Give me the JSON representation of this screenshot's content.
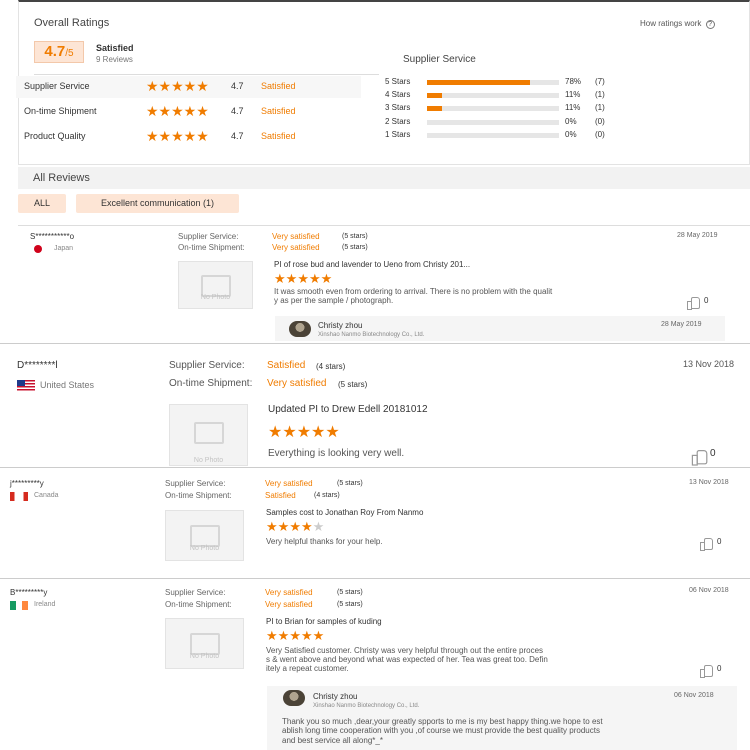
{
  "overall": {
    "title": "Overall Ratings",
    "how_link": "How ratings work",
    "score": "4.7",
    "score_suffix": "/5",
    "score_label": "Satisfied",
    "reviews_count": "9 Reviews",
    "rows": [
      {
        "label": "Supplier Service",
        "value": "4.7",
        "text": "Satisfied"
      },
      {
        "label": "On-time Shipment",
        "value": "4.7",
        "text": "Satisfied"
      },
      {
        "label": "Product Quality",
        "value": "4.7",
        "text": "Satisfied"
      }
    ],
    "supplier_service_title": "Supplier Service",
    "bars": [
      {
        "label": "5 Stars",
        "fraction": 0.78,
        "pct": "78%",
        "count": "(7)"
      },
      {
        "label": "4 Stars",
        "fraction": 0.11,
        "pct": "11%",
        "count": "(1)"
      },
      {
        "label": "3 Stars",
        "fraction": 0.11,
        "pct": "11%",
        "count": "(1)"
      },
      {
        "label": "2 Stars",
        "fraction": 0,
        "pct": "0%",
        "count": "(0)"
      },
      {
        "label": "1 Stars",
        "fraction": 0,
        "pct": "0%",
        "count": "(0)"
      }
    ]
  },
  "all_reviews": {
    "title": "All Reviews",
    "filters": [
      "ALL",
      "Excellent communication (1)"
    ]
  },
  "reviews": [
    {
      "name": "S***********o",
      "country": "Japan",
      "date": "28 May 2019",
      "ss_label": "Supplier Service:",
      "ss_value": "Very satisfied",
      "ss_stars": "(5 stars)",
      "os_label": "On-time Shipment:",
      "os_value": "Very satisfied",
      "os_stars": "(5 stars)",
      "product": "PI of rose bud and lavender to Ueno from Christy 201...",
      "rating": 5,
      "text_l1": "It was smooth even from ordering to arrival. There is no problem with the qualit",
      "text_l2": "y as per the sample / photograph.",
      "likes": "0",
      "no_photo": "No Photo",
      "reply": {
        "name": "Christy zhou",
        "company": "Xinshao Nanmo Biotechnology Co., Ltd.",
        "date": "28 May 2019"
      }
    },
    {
      "name": "D********l",
      "country": "United States",
      "date": "13 Nov 2018",
      "ss_label": "Supplier Service:",
      "ss_value": "Satisfied",
      "ss_stars": "(4 stars)",
      "os_label": "On-time Shipment:",
      "os_value": "Very satisfied",
      "os_stars": "(5 stars)",
      "product": "Updated PI to Drew Edell 20181012",
      "rating": 5,
      "text_l1": "Everything is looking very well.",
      "likes": "0",
      "no_photo": "No Photo"
    },
    {
      "name": "j*********y",
      "country": "Canada",
      "date": "13 Nov 2018",
      "ss_label": "Supplier Service:",
      "ss_value": "Very satisfied",
      "ss_stars": "(5 stars)",
      "os_label": "On-time Shipment:",
      "os_value": "Satisfied",
      "os_stars": "(4 stars)",
      "product": "Samples cost to Jonathan Roy From Nanmo",
      "rating": 4,
      "text_l1": "Very helpful thanks for your help.",
      "likes": "0",
      "no_photo": "No Photo"
    },
    {
      "name": "B*********y",
      "country": "Ireland",
      "date": "06 Nov 2018",
      "ss_label": "Supplier Service:",
      "ss_value": "Very satisfied",
      "ss_stars": "(5 stars)",
      "os_label": "On-time Shipment:",
      "os_value": "Very satisfied",
      "os_stars": "(5 stars)",
      "product": "PI to Brian for samples of kuding",
      "rating": 5,
      "text_l1": "Very Satisfied customer. Christy was very helpful through out the entire proces",
      "text_l2": "s & went above and beyond what was expected of her. Tea was great too. Defin",
      "text_l3": "itely a repeat customer.",
      "likes": "0",
      "no_photo": "No Photo",
      "reply": {
        "name": "Christy zhou",
        "company": "Xinshao Nanmo Biotechnology Co., Ltd.",
        "date": "06 Nov 2018",
        "text_l1": "Thank you so much ,dear,your greatly spports to me is my best happy thing.we hope to est",
        "text_l2": "ablish long time cooperation with you ,of course we must provide the best quality products",
        "text_l3": "and best service all along*_*"
      }
    }
  ],
  "colors": {
    "accent": "#f07c00",
    "chip_bg": "#fde5d5"
  }
}
